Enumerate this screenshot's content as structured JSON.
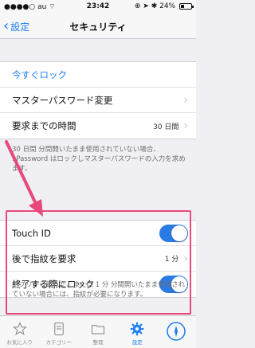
{
  "statusbar": {
    "carrier": "au",
    "time": "23:42",
    "battery": "24%"
  },
  "navbar": {
    "back_label": "設定",
    "title": "セキュリティ"
  },
  "section1": {
    "lock_now": "今すぐロック",
    "change_master_password": "マスターパスワード変更",
    "require_time_label": "要求までの時間",
    "require_time_value": "30 日間",
    "footer": "30 日間 分間開いたまま使用されていない場合、1Password はロックしマスターパスワードの入力を求めます。"
  },
  "section2": {
    "touch_id_label": "Touch ID",
    "touch_id_on": true,
    "require_fingerprint_label": "後で指紋を要求",
    "require_fingerprint_value": "1 分",
    "lock_on_exit_label": "終了する際にロック",
    "lock_on_exit_on": true,
    "footer": "アプリから離れた、または 1 分 分間開いたまま使用されていない場合には、指紋が必要になります。"
  },
  "tabbar": {
    "tabs": [
      {
        "label": "お気に入り",
        "icon": "star-icon",
        "active": false
      },
      {
        "label": "カテゴリー",
        "icon": "category-icon",
        "active": false
      },
      {
        "label": "整理",
        "icon": "folder-icon",
        "active": false
      },
      {
        "label": "設定",
        "icon": "gear-icon",
        "active": true
      },
      {
        "label": "",
        "icon": "compass-icon",
        "active": false
      }
    ]
  },
  "colors": {
    "accent": "#1a7cf4",
    "toggle_on": "#2b7be5",
    "highlight": "#e8487a"
  }
}
